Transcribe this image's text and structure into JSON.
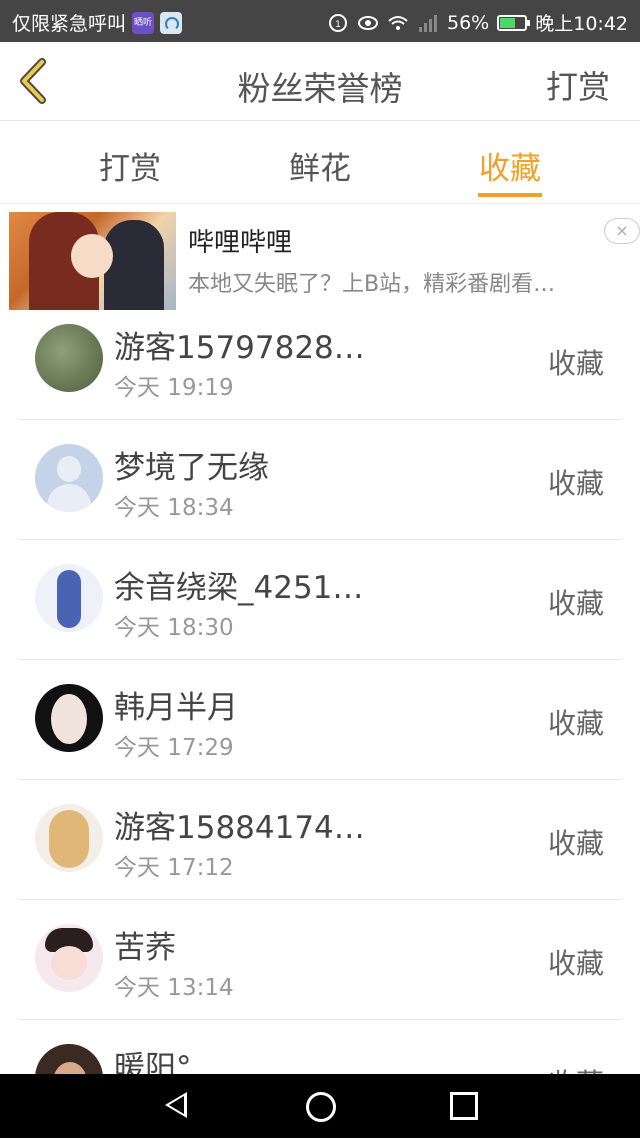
{
  "status_bar": {
    "carrier": "仅限紧急呼叫",
    "app_icon_1": "晒听",
    "battery_percent": "56%",
    "time": "晚上10:42",
    "icons": [
      "sync-icon",
      "eye-icon",
      "wifi-icon",
      "signal-icon",
      "battery-icon"
    ]
  },
  "header": {
    "title": "粉丝荣誉榜",
    "right_action": "打赏"
  },
  "tabs": [
    {
      "label": "打赏",
      "active": false
    },
    {
      "label": "鲜花",
      "active": false
    },
    {
      "label": "收藏",
      "active": true
    }
  ],
  "ad": {
    "title": "哔哩哔哩",
    "description": "本地又失眠了？上B站，精彩番剧看…",
    "close": "×"
  },
  "fans": [
    {
      "name": "游客15797828…",
      "time": "今天 19:19",
      "action": "收藏"
    },
    {
      "name": "梦境了无缘",
      "time": "今天 18:34",
      "action": "收藏"
    },
    {
      "name": "余音绕梁_4251…",
      "time": "今天 18:30",
      "action": "收藏"
    },
    {
      "name": "韩月半月",
      "time": "今天 17:29",
      "action": "收藏"
    },
    {
      "name": "游客15884174…",
      "time": "今天 17:12",
      "action": "收藏"
    },
    {
      "name": "苦荞",
      "time": "今天 13:14",
      "action": "收藏"
    },
    {
      "name": "暖阳°",
      "time": "",
      "action": "收藏"
    }
  ],
  "colors": {
    "accent": "#f1a127",
    "status_bar": "#454545",
    "nav_bar": "#000000"
  }
}
